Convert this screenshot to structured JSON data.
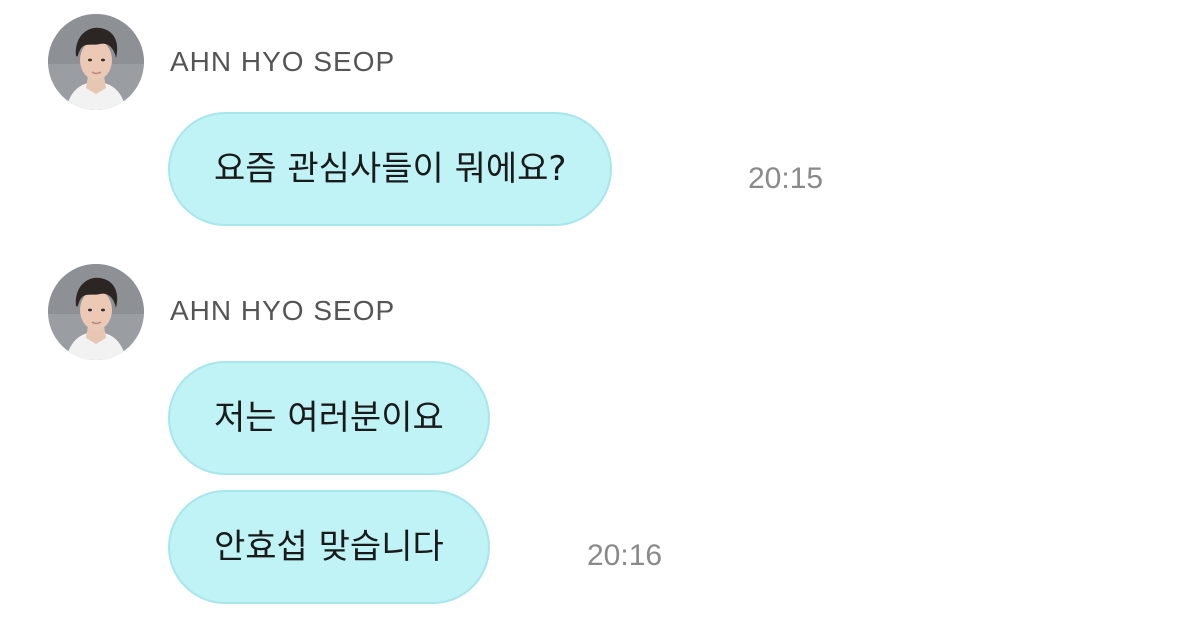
{
  "chat": {
    "groups": [
      {
        "sender": "AHN HYO SEOP",
        "messages": [
          {
            "text": "요즘 관심사들이 뭐에요?",
            "time": "20:15"
          }
        ]
      },
      {
        "sender": "AHN HYO SEOP",
        "messages": [
          {
            "text": "저는 여러분이요",
            "time": ""
          },
          {
            "text": "안효섭 맞습니다",
            "time": "20:16"
          }
        ]
      }
    ]
  },
  "colors": {
    "bubble": "#bff3f6",
    "bubble_border": "#a7e6eb",
    "sender_text": "#555555",
    "time_text": "#8a8a8a"
  },
  "icons": {
    "avatar": "profile-photo"
  }
}
